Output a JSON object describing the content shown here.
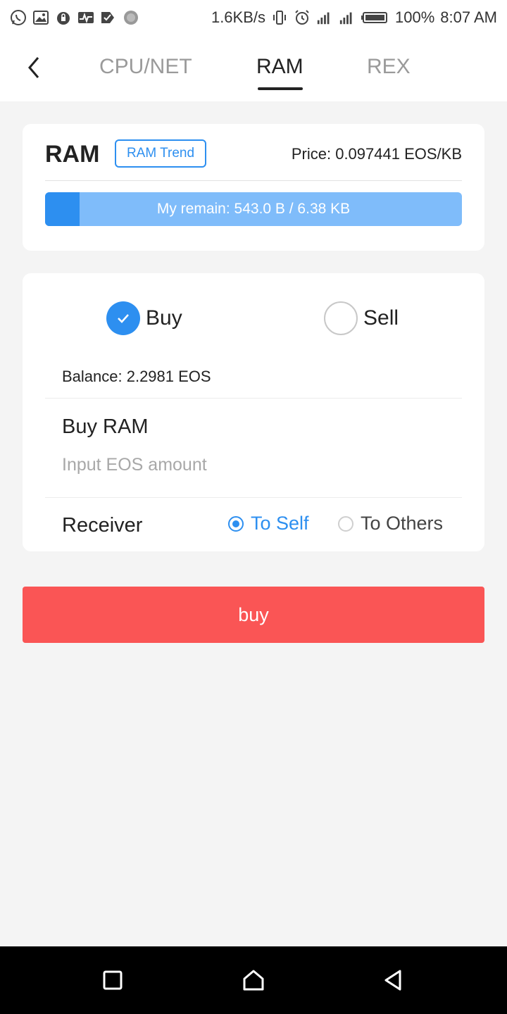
{
  "status_bar": {
    "left_icons": [
      "whatsapp-icon",
      "image-icon",
      "lock-icon",
      "activity-icon",
      "check-icon",
      "loading-icon"
    ],
    "net_speed": "1.6KB/s",
    "battery": "100%",
    "time": "8:07 AM"
  },
  "nav": {
    "tabs": [
      {
        "label": "CPU/NET",
        "active": false
      },
      {
        "label": "RAM",
        "active": true
      },
      {
        "label": "REX",
        "active": false
      }
    ]
  },
  "ram_card": {
    "title": "RAM",
    "trend_label": "RAM Trend",
    "price": "Price: 0.097441 EOS/KB",
    "remain_text": "My remain: 543.0 B / 6.38 KB",
    "remain_fraction": 0.083
  },
  "trade": {
    "options": [
      {
        "label": "Buy",
        "selected": true
      },
      {
        "label": "Sell",
        "selected": false
      }
    ],
    "balance": "Balance: 2.2981 EOS",
    "buy_ram_label": "Buy RAM",
    "input_placeholder": "Input EOS amount",
    "input_value": "",
    "receiver_label": "Receiver",
    "receivers": [
      {
        "label": "To Self",
        "selected": true
      },
      {
        "label": "To Others",
        "selected": false
      }
    ]
  },
  "action": {
    "buy_label": "buy"
  },
  "colors": {
    "accent": "#2d8ff0",
    "bar_light": "#7fbcfa",
    "buy_button": "#fa5555",
    "background": "#f4f4f4"
  }
}
